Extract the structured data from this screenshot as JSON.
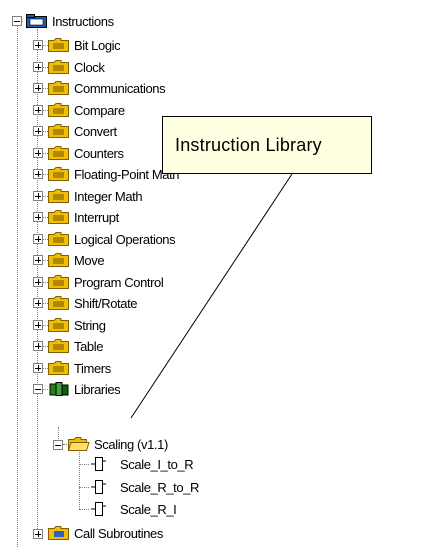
{
  "tree": {
    "root_label": "Instructions",
    "items": [
      {
        "label": "Bit Logic",
        "icon": "folder-icon"
      },
      {
        "label": "Clock",
        "icon": "folder-icon"
      },
      {
        "label": "Communications",
        "icon": "folder-icon"
      },
      {
        "label": "Compare",
        "icon": "folder-icon"
      },
      {
        "label": "Convert",
        "icon": "folder-icon"
      },
      {
        "label": "Counters",
        "icon": "folder-icon"
      },
      {
        "label": "Floating-Point Math",
        "icon": "folder-icon"
      },
      {
        "label": "Integer Math",
        "icon": "folder-icon"
      },
      {
        "label": "Interrupt",
        "icon": "folder-icon"
      },
      {
        "label": "Logical Operations",
        "icon": "folder-icon"
      },
      {
        "label": "Move",
        "icon": "folder-icon"
      },
      {
        "label": "Program Control",
        "icon": "folder-icon"
      },
      {
        "label": "Shift/Rotate",
        "icon": "folder-icon"
      },
      {
        "label": "String",
        "icon": "folder-icon"
      },
      {
        "label": "Table",
        "icon": "folder-icon"
      },
      {
        "label": "Timers",
        "icon": "folder-icon"
      },
      {
        "label": "Libraries",
        "icon": "library-icon"
      }
    ],
    "library_folder": {
      "label": "Scaling (v1.1)",
      "icon": "open-folder-icon"
    },
    "library_items": [
      {
        "label": "Scale_I_to_R",
        "icon": "block-icon"
      },
      {
        "label": "Scale_R_to_R",
        "icon": "block-icon"
      },
      {
        "label": "Scale_R_I",
        "icon": "block-icon"
      }
    ],
    "last_item": {
      "label": "Call Subroutines",
      "icon": "folder-icon"
    }
  },
  "callout": {
    "text": "Instruction  Library"
  },
  "colors": {
    "callout_bg": "#ffffe1",
    "folder": "#f0c000",
    "folder_dark": "#806000",
    "tree_lines": "#808080"
  }
}
